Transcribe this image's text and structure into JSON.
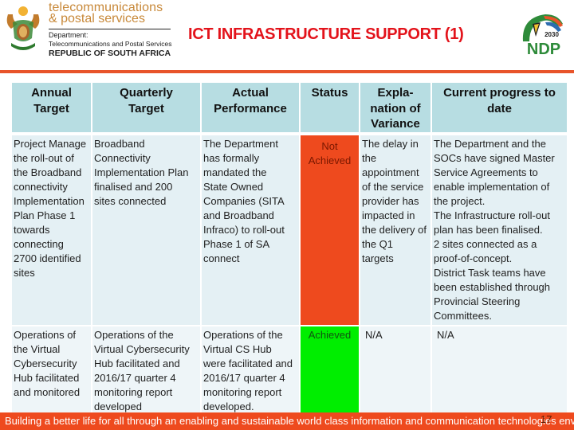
{
  "header": {
    "dept_logo": {
      "line1": "telecommunications",
      "line2": "& postal services",
      "line3": "Department:",
      "line4": "Telecommunications and Postal Services",
      "line5": "REPUBLIC OF SOUTH AFRICA"
    },
    "title": "ICT INFRASTRUCTURE SUPPORT (1)",
    "ndp_logo": {
      "year": "2030",
      "text": "NDP"
    }
  },
  "table": {
    "columns": [
      "Annual\nTarget",
      "Quarterly\nTarget",
      "Actual\nPerformance",
      "Status",
      "Expla-\nnation of\nVariance",
      "Current progress to\ndate"
    ],
    "rows": [
      {
        "annual_target": "Project Manage\nthe roll-out of\nthe Broadband\nconnectivity\nImplementation\nPlan Phase 1\ntowards\nconnecting\n2700 identified\nsites",
        "quarterly_target": "Broadband\nConnectivity\nImplementation Plan\nfinalised and 200\nsites connected",
        "actual_performance": "The Department\nhas formally\nmandated the\nState  Owned\nCompanies (SITA\nand Broadband\nInfraco) to roll-out\nPhase 1 of SA\nconnect",
        "status": "Not\nAchieved",
        "status_color": "#ee4a1e",
        "explanation": "The delay in\nthe\nappointment\nof the service\nprovider has\nimpacted in\nthe delivery of\nthe Q1\ntargets",
        "progress": "The Department and the\nSOCs have signed Master\nService Agreements to\nenable implementation of\nthe project.\nThe Infrastructure roll-out\nplan has been finalised.\n2 sites connected as a\nproof-of-concept.\nDistrict Task teams have\nbeen established through\nProvincial Steering\nCommittees."
      },
      {
        "annual_target": "Operations of\nthe Virtual\nCybersecurity\nHub facilitated\nand monitored",
        "quarterly_target": "Operations of the\nVirtual Cybersecurity\nHub facilitated and\n2016/17 quarter 4\nmonitoring report\ndeveloped",
        "actual_performance": "Operations of the\nVirtual CS Hub\nwere facilitated and\n2016/17 quarter 4\nmonitoring report\ndeveloped.",
        "status": "Achieved",
        "status_color": "#00ee00",
        "explanation": "N/A",
        "progress": "N/A"
      }
    ]
  },
  "footer": {
    "message": "Building a better life for all through an enabling and sustainable world class information and communication technologies environment.",
    "page_number": "17"
  },
  "colors": {
    "title_red": "#e3131b",
    "accent_orange": "#e8542a",
    "header_cell": "#b7dde2",
    "not_achieved": "#ee4a1e",
    "achieved": "#00ee00"
  }
}
